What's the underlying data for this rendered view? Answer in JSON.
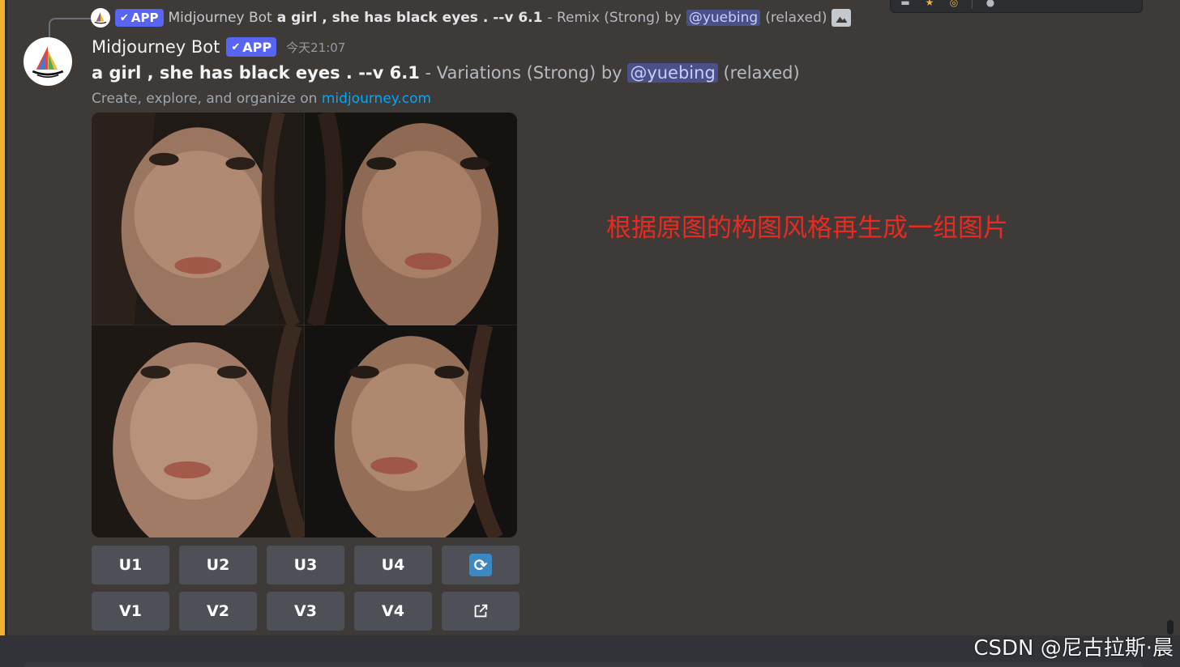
{
  "reply": {
    "bot_name": "Midjourney Bot",
    "badge": "APP",
    "prompt": "a girl , she has black eyes . --v 6.1",
    "mode": "- Remix (Strong) by",
    "mention": "@yuebing",
    "speed": "(relaxed)"
  },
  "message": {
    "author": "Midjourney Bot",
    "badge": "APP",
    "timestamp": "今天21:07",
    "prompt": "a girl , she has black eyes . --v 6.1",
    "mode": "- Variations (Strong) by",
    "mention": "@yuebing",
    "speed": "(relaxed)",
    "subtext": "Create, explore, and organize on",
    "link": "midjourney.com"
  },
  "buttons": {
    "upscale": [
      "U1",
      "U2",
      "U3",
      "U4"
    ],
    "variation": [
      "V1",
      "V2",
      "V3",
      "V4"
    ],
    "reroll_icon": "refresh-icon",
    "web_icon": "external-link-icon"
  },
  "annotation": "根据原图的构图风格再生成一组图片",
  "watermark": "CSDN @尼古拉斯·晨",
  "colors": {
    "background": "#3e3a37",
    "accent_bar": "#f0b232",
    "badge": "#5865f2",
    "button": "#4e5058",
    "link": "#00a8fc",
    "annotation": "#ea2a20"
  }
}
